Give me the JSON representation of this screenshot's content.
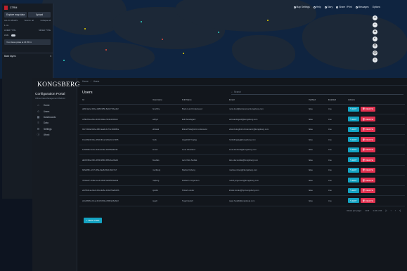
{
  "map_app": {
    "title": "CTRM",
    "buttons": {
      "explore": "Explore map data",
      "upload": "Upload"
    },
    "row1": {
      "left": "ALL IN 48 HRS",
      "mid": "Source: all",
      "right": "Collapse all"
    },
    "filter_label": "1 nm",
    "col_labels": {
      "a": "LINER TYPE",
      "b": "MIXED TYPE"
    },
    "toggle_label": "LIVE",
    "notice": "Your data update at 16:25:11",
    "layers_label": "Base layers",
    "toolbar": [
      "Map Settings",
      "Help",
      "Story",
      "Share / Print",
      "Messages",
      "Options"
    ],
    "zoom": [
      "+",
      "−",
      "●",
      "◐",
      "⊙",
      "◎",
      "⌂"
    ]
  },
  "portal": {
    "brand": "KONGSBERG",
    "title": "Configuration Portal",
    "subtitle": "Offline Data Management Platform",
    "nav": [
      {
        "label": "Home",
        "icon": "home-icon",
        "glyph": "⌂"
      },
      {
        "label": "Users",
        "icon": "user-icon",
        "glyph": "☺"
      },
      {
        "label": "Dashboards",
        "icon": "dashboard-icon",
        "glyph": "▦"
      },
      {
        "label": "Data",
        "icon": "database-icon",
        "glyph": "≡"
      },
      {
        "label": "Settings",
        "icon": "gear-icon",
        "glyph": "⚙"
      },
      {
        "label": "About",
        "icon": "info-icon",
        "glyph": "ⓘ"
      }
    ],
    "breadcrumb": [
      "Home",
      "Users"
    ],
    "page_title": "Users",
    "search_placeholder": "Search",
    "columns": [
      "Id",
      "Username",
      "Full Name",
      "Email",
      "Verified",
      "Enabled",
      "Actions"
    ],
    "rows": [
      {
        "id": "a08c4a2e-3b6e-4d89-9f5b-8a0c71fbed22",
        "username": "bnorbby",
        "fullname": "Bodo Lund Underwood",
        "email": "noria.lund@underwood.kongsberg.com",
        "verified": "false",
        "enabled": "true"
      },
      {
        "id": "c25b2f4a-ef0e-4b02-84de-21bfe44431c1",
        "username": "edbyd",
        "fullname": "Edit Sandsgard",
        "email": "edit.sandsgard@kongsberg.com",
        "verified": "false",
        "enabled": "true"
      },
      {
        "id": "04c7d2da-6d2e-49f2-aaa9-1c7ce13a56be",
        "username": "ebbeak",
        "fullname": "Erlend Skogholm Lindemann",
        "email": "erlend.skogholm.lindemann@kongsberg.com",
        "verified": "false",
        "enabled": "true"
      },
      {
        "id": "19cd0924-f04e-4f5d-8b1a-6d9e0c1c72b5",
        "username": "hsdv",
        "fullname": "Hagnhild Tinglag",
        "email": "hnilddtinglag@kongsberg.com",
        "verified": "false",
        "enabled": "true"
      },
      {
        "id": "1d94f0b2-1c2e-4c9d-b19e-0fd7f5a0b23c",
        "username": "lenow",
        "fullname": "Lena Oberland",
        "email": "lena.oberland@kongsberg.com",
        "verified": "false",
        "enabled": "true"
      },
      {
        "id": "a8c0195e-0fb1-4f93-8d5b-3f6b41e24a1d",
        "username": "ltsodlas",
        "fullname": "Lars Olav Sodlas",
        "email": "lars.olav.sodlas@kongsberg.com",
        "verified": "false",
        "enabled": "true"
      },
      {
        "id": "b0fa3f6b-c217-4f6a-9aa8-f0fe11b0c7a7",
        "username": "mortberg",
        "fullname": "Marita Omberg",
        "email": "marita.omberg@kongsberg.com",
        "verified": "false",
        "enabled": "true"
      },
      {
        "id": "7bff4a07-1b8a-4ee4-b6d4-5a03f5b3a2d9",
        "username": "rtsjberg",
        "fullname": "Rutherin Jorgensen",
        "email": "rudolf.jorgensen@kongsberg.com",
        "verified": "false",
        "enabled": "true"
      },
      {
        "id": "e6c5b21a-2de4-4fca-9a5e-1b4d70ad6d5b",
        "username": "sjoldin",
        "fullname": "Kristel Lunder",
        "email": "kristel.lunder@bpr.kongsberg.com",
        "verified": "false",
        "enabled": "true"
      },
      {
        "id": "2e1d8b8c-2c1a-4b15-8d3e-6f9f2ab6e8a3",
        "username": "tegeh",
        "fullname": "Tegel Hedell",
        "email": "tegel.hedell@kongsberg.com",
        "verified": "false",
        "enabled": "true"
      }
    ],
    "edit_label": "EDIT",
    "delete_label": "DELETE",
    "pager": {
      "rows_label": "Rows per page:",
      "rows_value": "10",
      "range": "1-10 of 11"
    },
    "add_label": "NEW USER"
  }
}
